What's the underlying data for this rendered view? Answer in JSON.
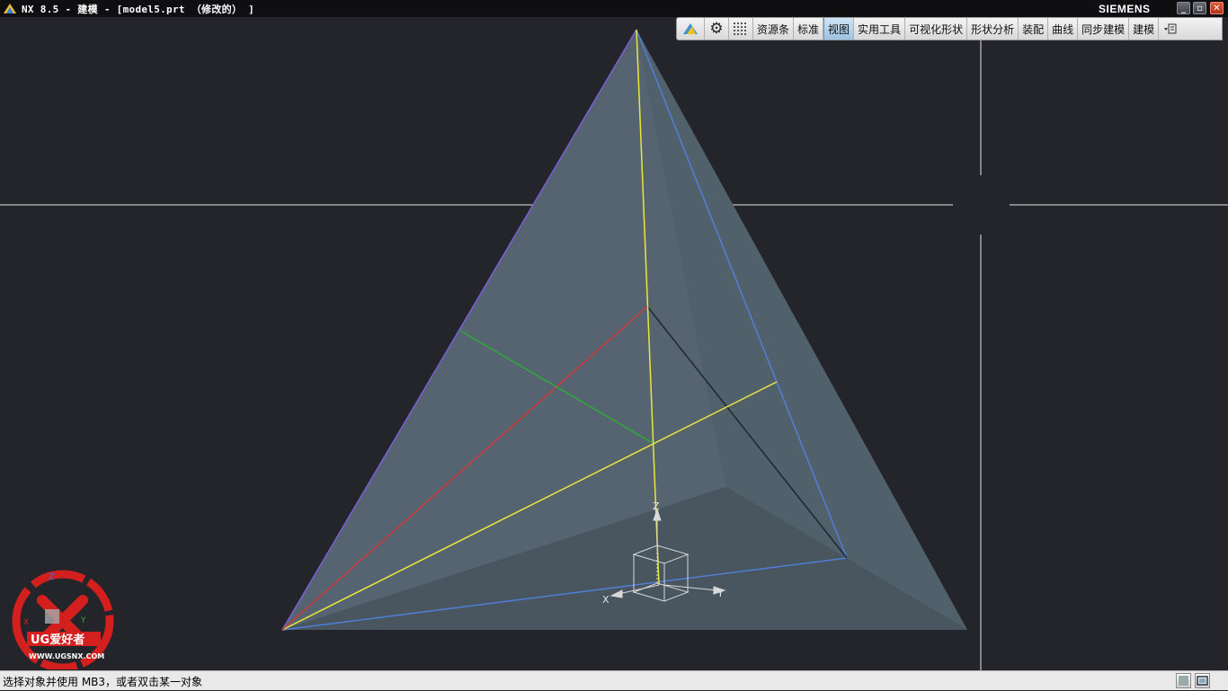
{
  "window": {
    "title": "NX 8.5 - 建模 - [model5.prt （修改的） ]",
    "brand": "SIEMENS",
    "controls": [
      "_",
      "▫",
      "✕"
    ]
  },
  "toolbar": {
    "tabs": [
      {
        "label": "资源条",
        "active": false
      },
      {
        "label": "标准",
        "active": false
      },
      {
        "label": "视图",
        "active": true
      },
      {
        "label": "实用工具",
        "active": false
      },
      {
        "label": "可视化形状",
        "active": false
      },
      {
        "label": "形状分析",
        "active": false
      },
      {
        "label": "装配",
        "active": false
      },
      {
        "label": "曲线",
        "active": false
      },
      {
        "label": "同步建模",
        "active": false
      },
      {
        "label": "建模",
        "active": false
      }
    ],
    "icons": [
      "render-style-icon",
      "gear-icon",
      "grid-icon",
      "toolbar-options-icon"
    ]
  },
  "triad": {
    "x": "X",
    "y": "Y",
    "z": "Z"
  },
  "watermark": {
    "logo_text": "UG爱好者",
    "url": "WWW.UGSNX.COM",
    "axes": [
      "Z",
      "X",
      "Y"
    ]
  },
  "status": {
    "prompt": "选择对象并使用 MB3，或者双击某一对象"
  },
  "colors": {
    "background": "#23252a",
    "active_tab": "#9fc3e3",
    "edge_blue": "#4f7fd6",
    "line_yellow": "#e8e83a",
    "line_red": "#d23a3a",
    "line_green": "#2faa3a"
  }
}
